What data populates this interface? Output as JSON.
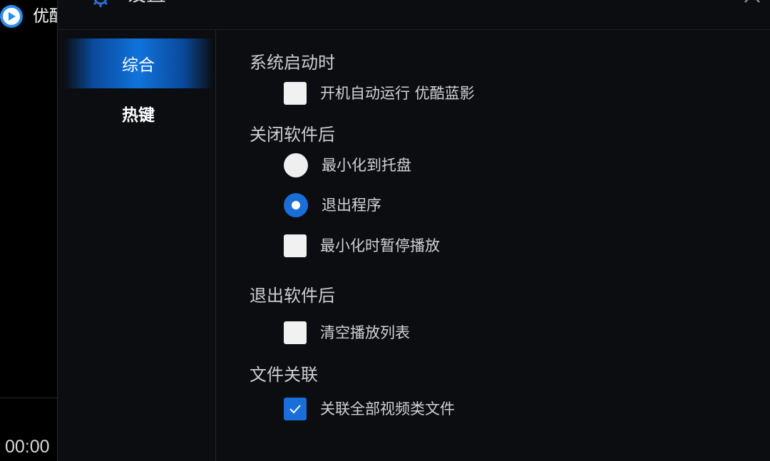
{
  "background_app": {
    "title": "优酷",
    "time": "00:00"
  },
  "dialog": {
    "title": "设置",
    "close_icon": "close-icon",
    "gear_icon": "gear-icon"
  },
  "sidebar": {
    "items": [
      {
        "label": "综合",
        "active": true
      },
      {
        "label": "热键",
        "active": false
      }
    ]
  },
  "sections": {
    "startup": {
      "title": "系统启动时",
      "options": [
        {
          "label": "开机自动运行 优酷蓝影",
          "type": "checkbox",
          "checked": false
        }
      ]
    },
    "close": {
      "title": "关闭软件后",
      "options": [
        {
          "label": "最小化到托盘",
          "type": "radio",
          "checked": false
        },
        {
          "label": "退出程序",
          "type": "radio",
          "checked": true
        },
        {
          "label": "最小化时暂停播放",
          "type": "checkbox",
          "checked": false
        }
      ]
    },
    "exit": {
      "title": "退出软件后",
      "options": [
        {
          "label": "清空播放列表",
          "type": "checkbox",
          "checked": false
        }
      ]
    },
    "file_assoc": {
      "title": "文件关联",
      "options": [
        {
          "label": "关联全部视频类文件",
          "type": "checkbox",
          "checked": true
        }
      ]
    }
  },
  "colors": {
    "accent": "#1a6ed8",
    "dialog_bg": "#0b0d11",
    "text": "#d2d2d2"
  }
}
